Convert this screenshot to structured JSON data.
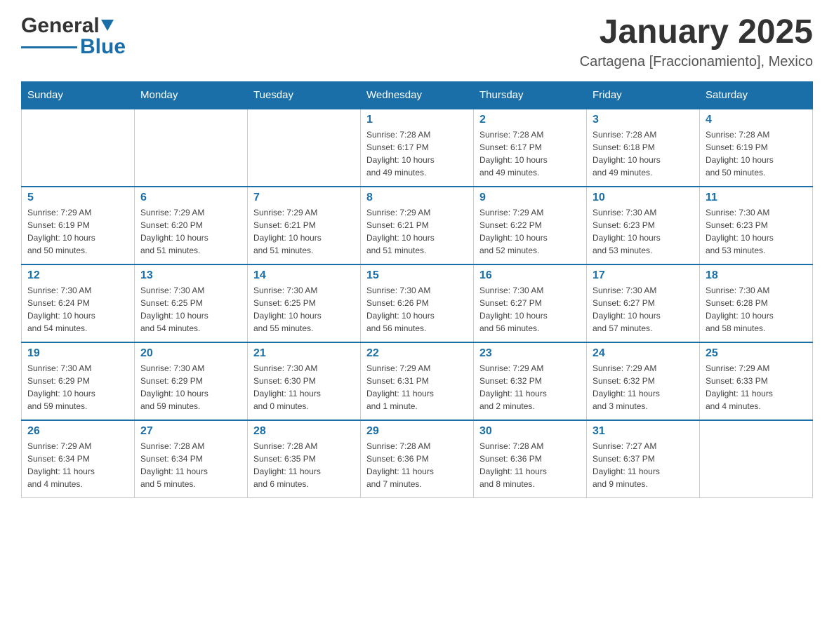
{
  "header": {
    "logo_general": "General",
    "logo_blue": "Blue",
    "title": "January 2025",
    "subtitle": "Cartagena [Fraccionamiento], Mexico"
  },
  "days_of_week": [
    "Sunday",
    "Monday",
    "Tuesday",
    "Wednesday",
    "Thursday",
    "Friday",
    "Saturday"
  ],
  "weeks": [
    [
      {
        "day": "",
        "info": ""
      },
      {
        "day": "",
        "info": ""
      },
      {
        "day": "",
        "info": ""
      },
      {
        "day": "1",
        "info": "Sunrise: 7:28 AM\nSunset: 6:17 PM\nDaylight: 10 hours\nand 49 minutes."
      },
      {
        "day": "2",
        "info": "Sunrise: 7:28 AM\nSunset: 6:17 PM\nDaylight: 10 hours\nand 49 minutes."
      },
      {
        "day": "3",
        "info": "Sunrise: 7:28 AM\nSunset: 6:18 PM\nDaylight: 10 hours\nand 49 minutes."
      },
      {
        "day": "4",
        "info": "Sunrise: 7:28 AM\nSunset: 6:19 PM\nDaylight: 10 hours\nand 50 minutes."
      }
    ],
    [
      {
        "day": "5",
        "info": "Sunrise: 7:29 AM\nSunset: 6:19 PM\nDaylight: 10 hours\nand 50 minutes."
      },
      {
        "day": "6",
        "info": "Sunrise: 7:29 AM\nSunset: 6:20 PM\nDaylight: 10 hours\nand 51 minutes."
      },
      {
        "day": "7",
        "info": "Sunrise: 7:29 AM\nSunset: 6:21 PM\nDaylight: 10 hours\nand 51 minutes."
      },
      {
        "day": "8",
        "info": "Sunrise: 7:29 AM\nSunset: 6:21 PM\nDaylight: 10 hours\nand 51 minutes."
      },
      {
        "day": "9",
        "info": "Sunrise: 7:29 AM\nSunset: 6:22 PM\nDaylight: 10 hours\nand 52 minutes."
      },
      {
        "day": "10",
        "info": "Sunrise: 7:30 AM\nSunset: 6:23 PM\nDaylight: 10 hours\nand 53 minutes."
      },
      {
        "day": "11",
        "info": "Sunrise: 7:30 AM\nSunset: 6:23 PM\nDaylight: 10 hours\nand 53 minutes."
      }
    ],
    [
      {
        "day": "12",
        "info": "Sunrise: 7:30 AM\nSunset: 6:24 PM\nDaylight: 10 hours\nand 54 minutes."
      },
      {
        "day": "13",
        "info": "Sunrise: 7:30 AM\nSunset: 6:25 PM\nDaylight: 10 hours\nand 54 minutes."
      },
      {
        "day": "14",
        "info": "Sunrise: 7:30 AM\nSunset: 6:25 PM\nDaylight: 10 hours\nand 55 minutes."
      },
      {
        "day": "15",
        "info": "Sunrise: 7:30 AM\nSunset: 6:26 PM\nDaylight: 10 hours\nand 56 minutes."
      },
      {
        "day": "16",
        "info": "Sunrise: 7:30 AM\nSunset: 6:27 PM\nDaylight: 10 hours\nand 56 minutes."
      },
      {
        "day": "17",
        "info": "Sunrise: 7:30 AM\nSunset: 6:27 PM\nDaylight: 10 hours\nand 57 minutes."
      },
      {
        "day": "18",
        "info": "Sunrise: 7:30 AM\nSunset: 6:28 PM\nDaylight: 10 hours\nand 58 minutes."
      }
    ],
    [
      {
        "day": "19",
        "info": "Sunrise: 7:30 AM\nSunset: 6:29 PM\nDaylight: 10 hours\nand 59 minutes."
      },
      {
        "day": "20",
        "info": "Sunrise: 7:30 AM\nSunset: 6:29 PM\nDaylight: 10 hours\nand 59 minutes."
      },
      {
        "day": "21",
        "info": "Sunrise: 7:30 AM\nSunset: 6:30 PM\nDaylight: 11 hours\nand 0 minutes."
      },
      {
        "day": "22",
        "info": "Sunrise: 7:29 AM\nSunset: 6:31 PM\nDaylight: 11 hours\nand 1 minute."
      },
      {
        "day": "23",
        "info": "Sunrise: 7:29 AM\nSunset: 6:32 PM\nDaylight: 11 hours\nand 2 minutes."
      },
      {
        "day": "24",
        "info": "Sunrise: 7:29 AM\nSunset: 6:32 PM\nDaylight: 11 hours\nand 3 minutes."
      },
      {
        "day": "25",
        "info": "Sunrise: 7:29 AM\nSunset: 6:33 PM\nDaylight: 11 hours\nand 4 minutes."
      }
    ],
    [
      {
        "day": "26",
        "info": "Sunrise: 7:29 AM\nSunset: 6:34 PM\nDaylight: 11 hours\nand 4 minutes."
      },
      {
        "day": "27",
        "info": "Sunrise: 7:28 AM\nSunset: 6:34 PM\nDaylight: 11 hours\nand 5 minutes."
      },
      {
        "day": "28",
        "info": "Sunrise: 7:28 AM\nSunset: 6:35 PM\nDaylight: 11 hours\nand 6 minutes."
      },
      {
        "day": "29",
        "info": "Sunrise: 7:28 AM\nSunset: 6:36 PM\nDaylight: 11 hours\nand 7 minutes."
      },
      {
        "day": "30",
        "info": "Sunrise: 7:28 AM\nSunset: 6:36 PM\nDaylight: 11 hours\nand 8 minutes."
      },
      {
        "day": "31",
        "info": "Sunrise: 7:27 AM\nSunset: 6:37 PM\nDaylight: 11 hours\nand 9 minutes."
      },
      {
        "day": "",
        "info": ""
      }
    ]
  ]
}
